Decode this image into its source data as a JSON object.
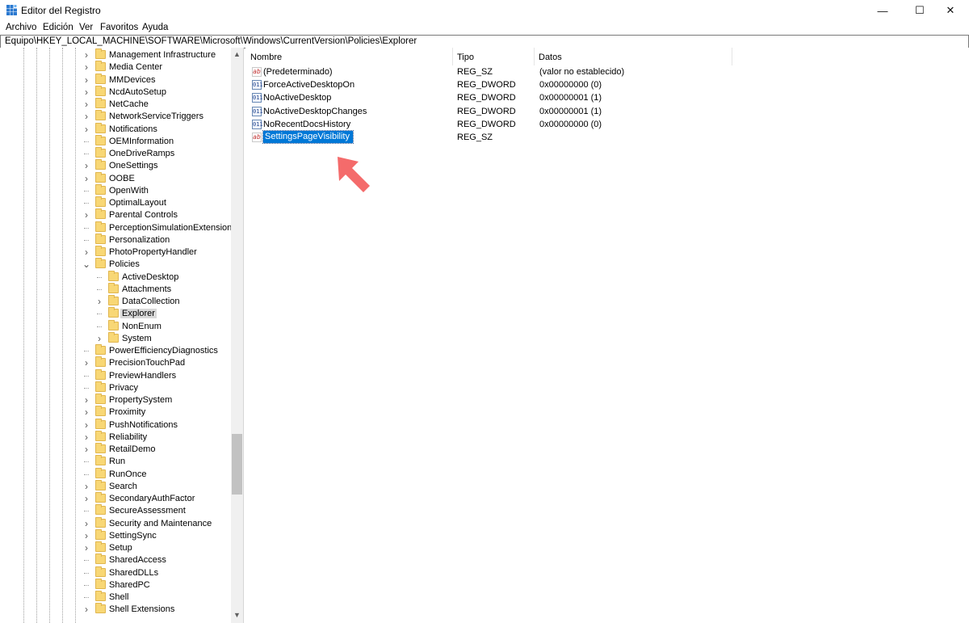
{
  "window": {
    "title": "Editor del Registro",
    "controls": {
      "minimize": "—",
      "maximize": "☐",
      "close": "✕"
    }
  },
  "menu": [
    "Archivo",
    "Edición",
    "Ver",
    "Favoritos",
    "Ayuda"
  ],
  "address": "Equipo\\HKEY_LOCAL_MACHINE\\SOFTWARE\\Microsoft\\Windows\\CurrentVersion\\Policies\\Explorer",
  "tree": {
    "items": [
      {
        "label": "Management Infrastructure",
        "level": 1,
        "expander": ">"
      },
      {
        "label": "Media Center",
        "level": 1,
        "expander": ">"
      },
      {
        "label": "MMDevices",
        "level": 1,
        "expander": ">"
      },
      {
        "label": "NcdAutoSetup",
        "level": 1,
        "expander": ">"
      },
      {
        "label": "NetCache",
        "level": 1,
        "expander": ">"
      },
      {
        "label": "NetworkServiceTriggers",
        "level": 1,
        "expander": ">"
      },
      {
        "label": "Notifications",
        "level": 1,
        "expander": ">"
      },
      {
        "label": "OEMInformation",
        "level": 1,
        "expander": ""
      },
      {
        "label": "OneDriveRamps",
        "level": 1,
        "expander": ""
      },
      {
        "label": "OneSettings",
        "level": 1,
        "expander": ">"
      },
      {
        "label": "OOBE",
        "level": 1,
        "expander": ">"
      },
      {
        "label": "OpenWith",
        "level": 1,
        "expander": ""
      },
      {
        "label": "OptimalLayout",
        "level": 1,
        "expander": ""
      },
      {
        "label": "Parental Controls",
        "level": 1,
        "expander": ">"
      },
      {
        "label": "PerceptionSimulationExtensions",
        "level": 1,
        "expander": ""
      },
      {
        "label": "Personalization",
        "level": 1,
        "expander": ""
      },
      {
        "label": "PhotoPropertyHandler",
        "level": 1,
        "expander": ">"
      },
      {
        "label": "Policies",
        "level": 1,
        "expander": "v"
      },
      {
        "label": "ActiveDesktop",
        "level": 2,
        "expander": ""
      },
      {
        "label": "Attachments",
        "level": 2,
        "expander": ""
      },
      {
        "label": "DataCollection",
        "level": 2,
        "expander": ">"
      },
      {
        "label": "Explorer",
        "level": 2,
        "expander": "",
        "selected": true
      },
      {
        "label": "NonEnum",
        "level": 2,
        "expander": ""
      },
      {
        "label": "System",
        "level": 2,
        "expander": ">"
      },
      {
        "label": "PowerEfficiencyDiagnostics",
        "level": 1,
        "expander": ""
      },
      {
        "label": "PrecisionTouchPad",
        "level": 1,
        "expander": ">"
      },
      {
        "label": "PreviewHandlers",
        "level": 1,
        "expander": ""
      },
      {
        "label": "Privacy",
        "level": 1,
        "expander": ""
      },
      {
        "label": "PropertySystem",
        "level": 1,
        "expander": ">"
      },
      {
        "label": "Proximity",
        "level": 1,
        "expander": ">"
      },
      {
        "label": "PushNotifications",
        "level": 1,
        "expander": ">"
      },
      {
        "label": "Reliability",
        "level": 1,
        "expander": ">"
      },
      {
        "label": "RetailDemo",
        "level": 1,
        "expander": ">"
      },
      {
        "label": "Run",
        "level": 1,
        "expander": ""
      },
      {
        "label": "RunOnce",
        "level": 1,
        "expander": ""
      },
      {
        "label": "Search",
        "level": 1,
        "expander": ">"
      },
      {
        "label": "SecondaryAuthFactor",
        "level": 1,
        "expander": ">"
      },
      {
        "label": "SecureAssessment",
        "level": 1,
        "expander": ""
      },
      {
        "label": "Security and Maintenance",
        "level": 1,
        "expander": ">"
      },
      {
        "label": "SettingSync",
        "level": 1,
        "expander": ">"
      },
      {
        "label": "Setup",
        "level": 1,
        "expander": ">"
      },
      {
        "label": "SharedAccess",
        "level": 1,
        "expander": ""
      },
      {
        "label": "SharedDLLs",
        "level": 1,
        "expander": ""
      },
      {
        "label": "SharedPC",
        "level": 1,
        "expander": ""
      },
      {
        "label": "Shell",
        "level": 1,
        "expander": ""
      },
      {
        "label": "Shell Extensions",
        "level": 1,
        "expander": ">"
      }
    ]
  },
  "list": {
    "columns": [
      "Nombre",
      "Tipo",
      "Datos"
    ],
    "rows": [
      {
        "name": "(Predeterminado)",
        "type": "REG_SZ",
        "data": "(valor no establecido)",
        "icon": "string-value-icon"
      },
      {
        "name": "ForceActiveDesktopOn",
        "type": "REG_DWORD",
        "data": "0x00000000 (0)",
        "icon": "dword-value-icon"
      },
      {
        "name": "NoActiveDesktop",
        "type": "REG_DWORD",
        "data": "0x00000001 (1)",
        "icon": "dword-value-icon"
      },
      {
        "name": "NoActiveDesktopChanges",
        "type": "REG_DWORD",
        "data": "0x00000001 (1)",
        "icon": "dword-value-icon"
      },
      {
        "name": "NoRecentDocsHistory",
        "type": "REG_DWORD",
        "data": "0x00000000 (0)",
        "icon": "dword-value-icon"
      },
      {
        "name": "SettingsPageVisibility",
        "type": "REG_SZ",
        "data": "",
        "icon": "string-value-icon",
        "selected": true
      }
    ]
  },
  "colors": {
    "selection": "#0078d7",
    "folder": "#f8d775",
    "annotation_arrow": "#f46b6b"
  }
}
